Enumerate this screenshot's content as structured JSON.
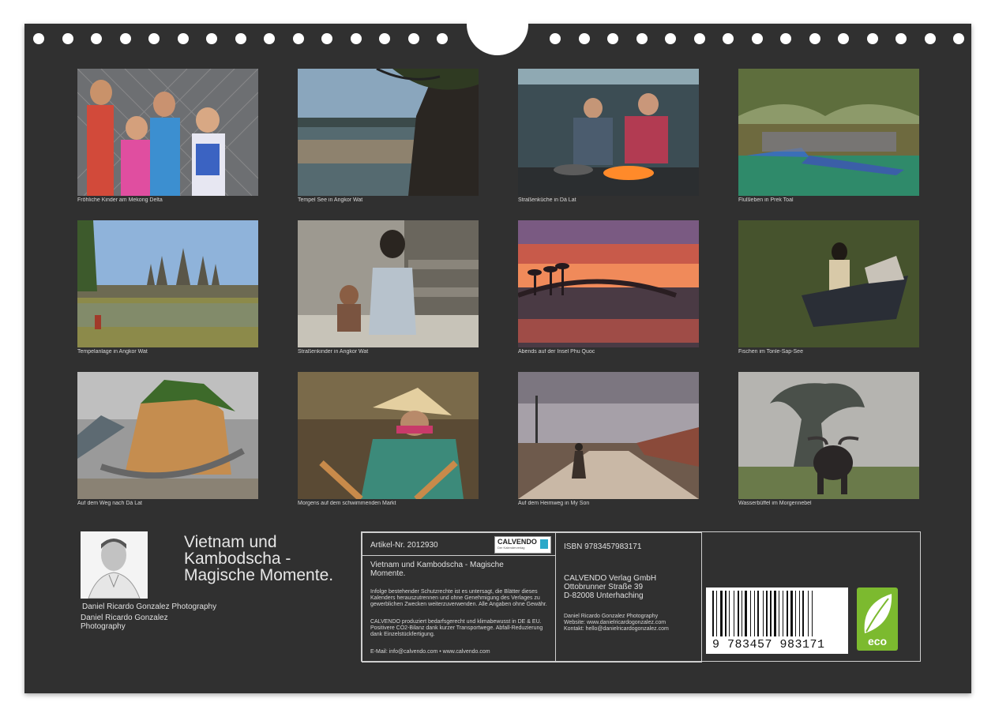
{
  "photos": [
    {
      "caption": "Fröhliche Kinder am Mekong Delta",
      "icon": "children-photo"
    },
    {
      "caption": "Tempel See in Angkor Wat",
      "icon": "temple-lake-photo"
    },
    {
      "caption": "Straßenküche in Dà Lat",
      "icon": "street-kitchen-photo"
    },
    {
      "caption": "Flußleben in Prek Toal",
      "icon": "river-life-photo"
    },
    {
      "caption": "Tempelanlage in Angkor Wat",
      "icon": "angkor-wat-photo"
    },
    {
      "caption": "Straßenkinder in Angkor Wat",
      "icon": "street-children-photo"
    },
    {
      "caption": "Abends auf der Insel Phu Quoc",
      "icon": "sunset-pier-photo"
    },
    {
      "caption": "Fischen im Tonle-Sap-See",
      "icon": "fishing-boat-photo"
    },
    {
      "caption": "Auf dem Weg nach Dà Lat",
      "icon": "mountain-road-photo"
    },
    {
      "caption": "Morgens auf dem schwimmenden Markt",
      "icon": "floating-market-photo"
    },
    {
      "caption": "Auf dem Heimweg in My Son",
      "icon": "homeward-road-photo"
    },
    {
      "caption": "Wasserbüffel im Morgennebel",
      "icon": "water-buffalo-photo"
    }
  ],
  "calendar": {
    "title": "Vietnam und Kambodscha - Magische Momente.",
    "photographer_line1": "Daniel Ricardo Gonzalez Photography",
    "photographer_line2": "Daniel Ricardo Gonzalez Photography"
  },
  "info": {
    "article": "Artikel-Nr. 2012930",
    "logo_text": "CALVENDO",
    "logo_sub": "Der Kalenderverlag",
    "product_title": "Vietnam und Kambodscha - Magische Momente.",
    "rights_text": "Infolge bestehender Schutzrechte ist es untersagt, die Blätter dieses Kalenders herauszutrennen und ohne Genehmigung des Verlages zu gewerblichen Zwecken weiterzuverwenden. Alle Angaben ohne Gewähr.",
    "eco_text": "CALVENDO produziert bedarfsgerecht und klimabewusst in DE & EU. Positivere CO2-Bilanz dank kurzer Transportwege. Abfall-Reduzierung dank Einzelstückfertigung.",
    "email": "E-Mail: info@calvendo.com • www.calvendo.com",
    "isbn": "ISBN 9783457983171",
    "publisher_name": "CALVENDO Verlag GmbH",
    "publisher_street": "Ottobrunner Straße 39",
    "publisher_city": "D-82008 Unterhaching",
    "contact_name": "Daniel Ricardo Gonzalez Photography",
    "contact_web": "Website: www.danielricardogonzalez.com",
    "contact_mail": "Kontakt: hello@danielricardogonzalez.com",
    "barcode_number": "9 783457 983171",
    "eco_label": "eco"
  },
  "colors": {
    "page": "#303030",
    "eco": "#7cba2f",
    "calvendo_accent": "#2aa8c9"
  }
}
